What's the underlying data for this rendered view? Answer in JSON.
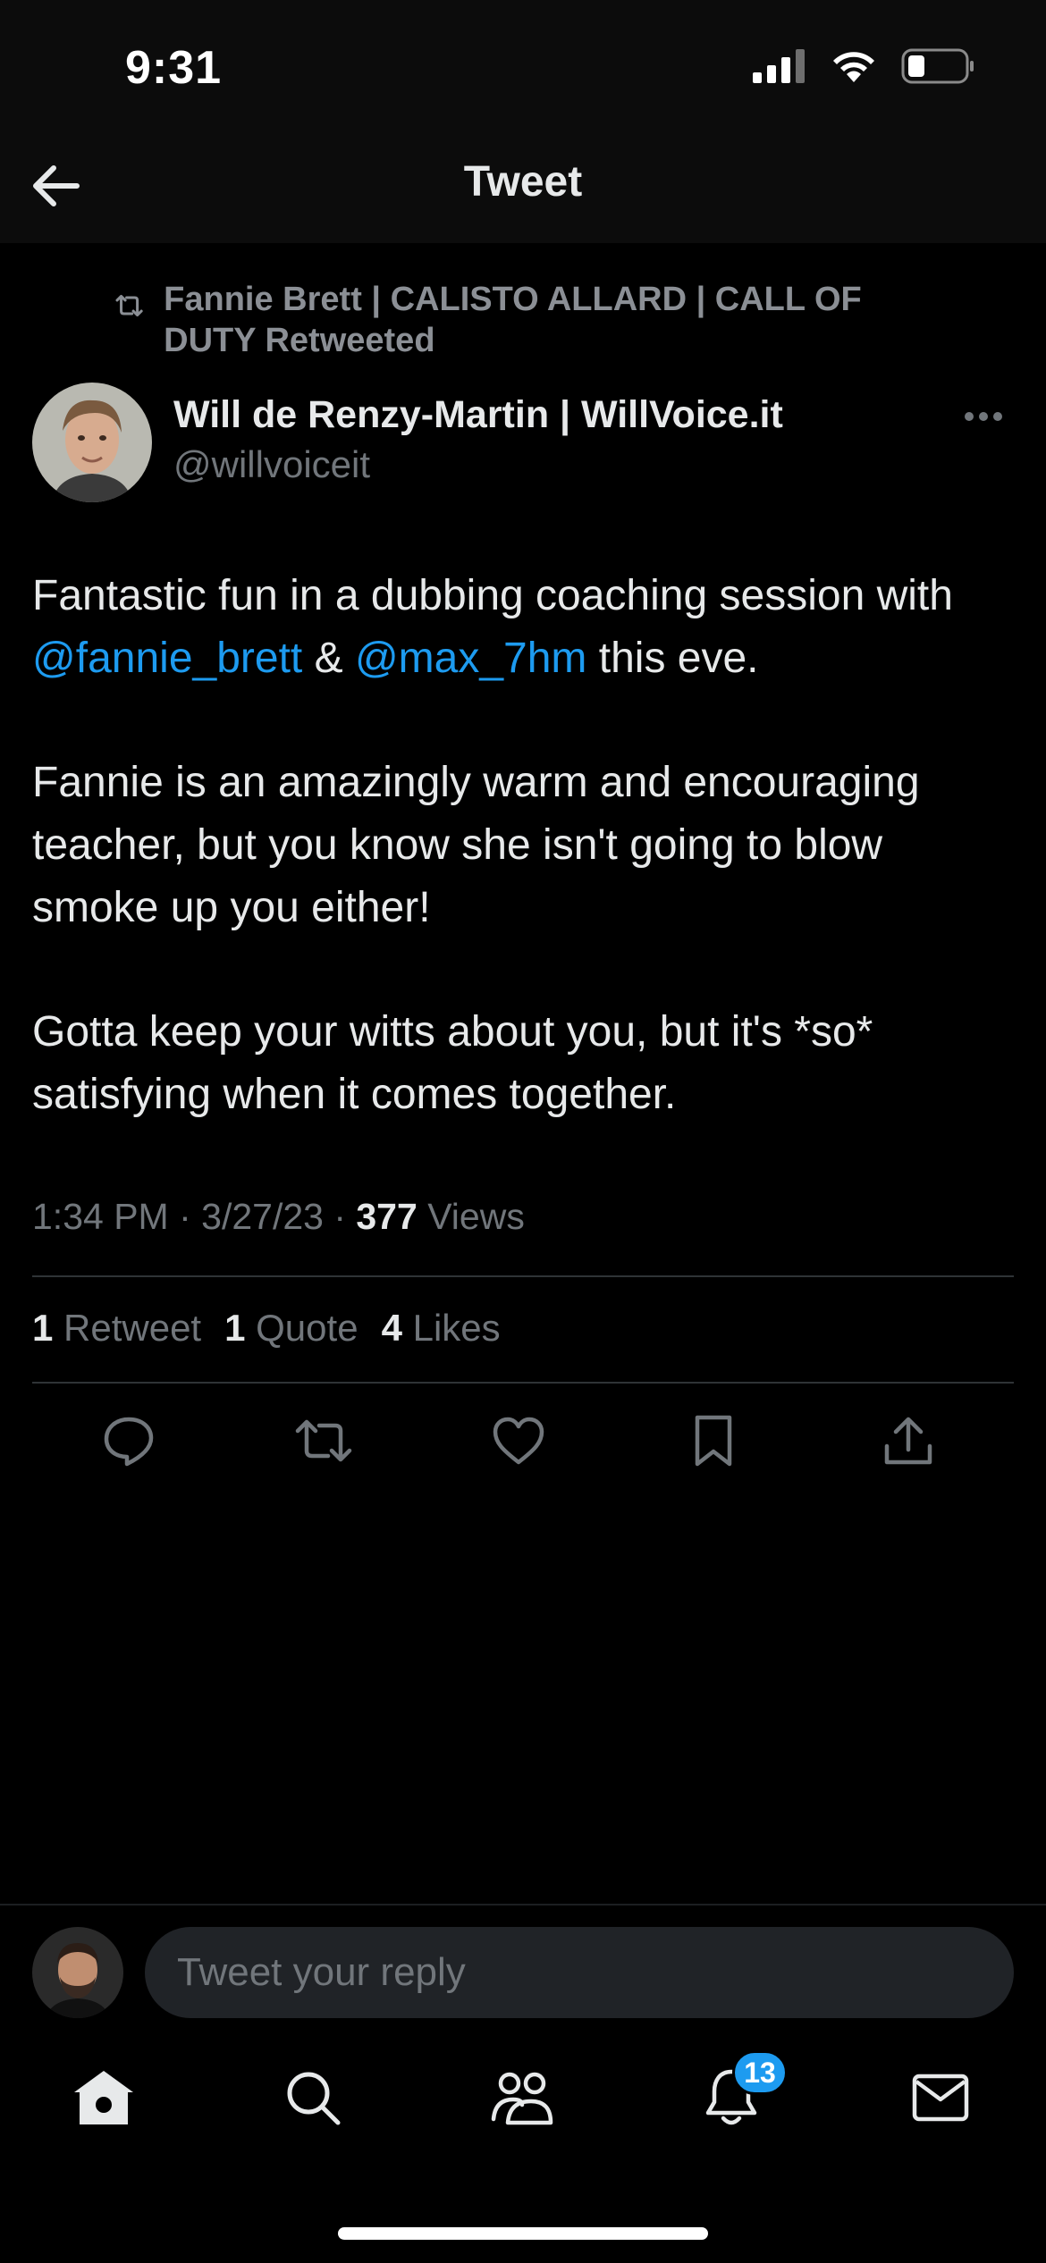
{
  "status_bar": {
    "time": "9:31"
  },
  "header": {
    "title": "Tweet"
  },
  "retweet_context": {
    "text": "Fannie Brett | CALISTO ALLARD | CALL OF DUTY Retweeted"
  },
  "author": {
    "name": "Will de Renzy-Martin | WillVoice.it",
    "handle": "@willvoiceit"
  },
  "tweet": {
    "p1_pre": "Fantastic fun in a dubbing coaching session with ",
    "mention1": "@fannie_brett",
    "p1_mid": " & ",
    "mention2": "@max_7hm",
    "p1_post": " this eve.",
    "p2": "Fannie is an amazingly warm and encouraging teacher, but you know she isn't going to blow smoke up you either!",
    "p3": "Gotta keep your witts about you, but it's *so* satisfying when it comes together."
  },
  "meta": {
    "time": "1:34 PM",
    "date": "3/27/23",
    "sep": " · ",
    "views_count": "377",
    "views_label": " Views"
  },
  "stats": {
    "retweets_count": "1",
    "retweets_label": " Retweet",
    "quotes_count": "1",
    "quotes_label": " Quote",
    "likes_count": "4",
    "likes_label": " Likes"
  },
  "reply": {
    "placeholder": "Tweet your reply"
  },
  "nav": {
    "notifications_badge": "13"
  },
  "icons": {
    "back": "arrow-left-icon",
    "retweet": "retweet-icon",
    "more": "more-icon",
    "reply": "reply-icon",
    "like": "heart-icon",
    "bookmark": "bookmark-icon",
    "share": "share-icon",
    "home": "home-icon",
    "search": "search-icon",
    "communities": "communities-icon",
    "notifications": "bell-icon",
    "messages": "mail-icon"
  },
  "colors": {
    "accent": "#1d9bf0",
    "background": "#000000",
    "text": "#e7e9ea",
    "muted": "#71767b"
  }
}
